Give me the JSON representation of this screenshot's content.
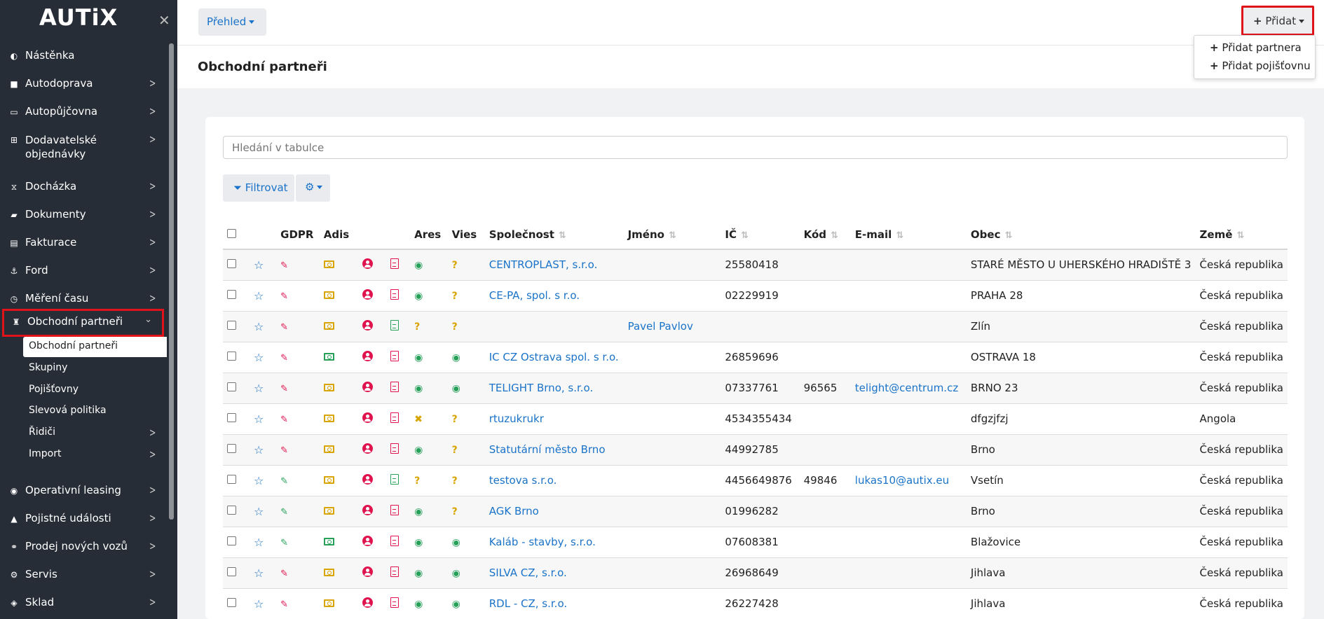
{
  "app": {
    "logo": "AUTiX"
  },
  "sidebar": {
    "items": [
      {
        "label": "Nástěnka",
        "icon": "dashboard-icon"
      },
      {
        "label": "Autodoprava",
        "icon": "truck-icon"
      },
      {
        "label": "Autopůjčovna",
        "icon": "car-rental-icon"
      },
      {
        "label": "Dodavatelské objednávky",
        "icon": "cart-icon"
      },
      {
        "label": "Docházka",
        "icon": "hourglass-icon"
      },
      {
        "label": "Dokumenty",
        "icon": "folder-icon"
      },
      {
        "label": "Fakturace",
        "icon": "invoice-icon"
      },
      {
        "label": "Ford",
        "icon": "anchor-icon"
      },
      {
        "label": "Měření času",
        "icon": "clock-icon"
      },
      {
        "label": "Obchodní partneři",
        "icon": "partners-icon"
      },
      {
        "label": "Operativní leasing",
        "icon": "car-icon"
      },
      {
        "label": "Pojistné události",
        "icon": "warning-icon"
      },
      {
        "label": "Prodej nových vozů",
        "icon": "handshake-icon"
      },
      {
        "label": "Servis",
        "icon": "cogs-icon"
      },
      {
        "label": "Sklad",
        "icon": "box-icon"
      }
    ],
    "subitems": [
      {
        "label": "Obchodní partneři"
      },
      {
        "label": "Skupiny"
      },
      {
        "label": "Pojišťovny"
      },
      {
        "label": "Slevová politika"
      },
      {
        "label": "Řidiči"
      },
      {
        "label": "Import"
      }
    ]
  },
  "topbar": {
    "overview_label": "Přehled",
    "add_label": "Přidat",
    "add_menu": [
      "Přidat partnera",
      "Přidat pojišťovnu"
    ]
  },
  "page": {
    "title": "Obchodní partneři"
  },
  "toolbar": {
    "search_placeholder": "Hledání v tabulce",
    "filter_label": "Filtrovat"
  },
  "table": {
    "columns": [
      "GDPR",
      "Adis",
      "Ares",
      "Vies",
      "Společnost",
      "Jméno",
      "IČ",
      "Kód",
      "E-mail",
      "Obec",
      "Země"
    ],
    "rows": [
      {
        "gdpr": "red",
        "adis": "yellow",
        "doc": "red",
        "ares": "eye",
        "vies": "q",
        "company": "CENTROPLAST, s.r.o.",
        "name": "",
        "ic": "25580418",
        "kod": "",
        "email": "",
        "obec": "STARÉ MĚSTO U UHERSKÉHO HRADIŠTĚ 3",
        "zeme": "Česká republika"
      },
      {
        "gdpr": "red",
        "adis": "yellow",
        "doc": "red",
        "ares": "eye",
        "vies": "q",
        "company": "CE-PA, spol. s r.o.",
        "name": "",
        "ic": "02229919",
        "kod": "",
        "email": "",
        "obec": "PRAHA 28",
        "zeme": "Česká republika"
      },
      {
        "gdpr": "red",
        "adis": "yellow",
        "doc": "green",
        "ares": "q",
        "vies": "q",
        "company": "",
        "name": "Pavel Pavlov",
        "ic": "",
        "kod": "",
        "email": "",
        "obec": "Zlín",
        "zeme": "Česká republika"
      },
      {
        "gdpr": "red",
        "adis": "green",
        "doc": "red",
        "ares": "eye",
        "vies": "eye",
        "company": "IC CZ Ostrava spol. s r.o.",
        "name": "",
        "ic": "26859696",
        "kod": "",
        "email": "",
        "obec": "OSTRAVA 18",
        "zeme": "Česká republika"
      },
      {
        "gdpr": "red",
        "adis": "yellow",
        "doc": "red",
        "ares": "eye",
        "vies": "eye",
        "company": "TELIGHT Brno, s.r.o.",
        "name": "",
        "ic": "07337761",
        "kod": "96565",
        "email": "telight@centrum.cz",
        "obec": "BRNO 23",
        "zeme": "Česká republika"
      },
      {
        "gdpr": "red",
        "adis": "yellow",
        "doc": "red",
        "ares": "x",
        "vies": "q",
        "company": "rtuzukrukr",
        "name": "",
        "ic": "4534355434",
        "kod": "",
        "email": "",
        "obec": "dfgzjfzj",
        "zeme": "Angola"
      },
      {
        "gdpr": "red",
        "adis": "yellow",
        "doc": "red",
        "ares": "eye",
        "vies": "q",
        "company": "Statutární město Brno",
        "name": "",
        "ic": "44992785",
        "kod": "",
        "email": "",
        "obec": "Brno",
        "zeme": "Česká republika"
      },
      {
        "gdpr": "green",
        "adis": "yellow",
        "doc": "green",
        "ares": "q",
        "vies": "q",
        "company": "testova s.r.o.",
        "name": "",
        "ic": "4456649876",
        "kod": "49846",
        "email": "lukas10@autix.eu",
        "obec": "Vsetín",
        "zeme": "Česká republika"
      },
      {
        "gdpr": "green",
        "adis": "yellow",
        "doc": "red",
        "ares": "eye",
        "vies": "q",
        "company": "AGK Brno",
        "name": "",
        "ic": "01996282",
        "kod": "",
        "email": "",
        "obec": "Brno",
        "zeme": "Česká republika"
      },
      {
        "gdpr": "green",
        "adis": "green",
        "doc": "red",
        "ares": "eye",
        "vies": "eye",
        "company": "Kaláb - stavby, s.r.o.",
        "name": "",
        "ic": "07608381",
        "kod": "",
        "email": "",
        "obec": "Blažovice",
        "zeme": "Česká republika"
      },
      {
        "gdpr": "red",
        "adis": "yellow",
        "doc": "red",
        "ares": "eye",
        "vies": "eye",
        "company": "SILVA CZ, s.r.o.",
        "name": "",
        "ic": "26968649",
        "kod": "",
        "email": "",
        "obec": "Jihlava",
        "zeme": "Česká republika"
      },
      {
        "gdpr": "red",
        "adis": "yellow",
        "doc": "red",
        "ares": "eye",
        "vies": "eye",
        "company": "RDL - CZ, s.r.o.",
        "name": "",
        "ic": "26227428",
        "kod": "",
        "email": "",
        "obec": "Jihlava",
        "zeme": "Česká republika"
      }
    ]
  },
  "colors": {
    "sidebar_bg": "#272d36",
    "link": "#1a73c9",
    "highlight": "#e0131b",
    "danger": "#e0134e",
    "success": "#27a05a",
    "warning": "#d8a400"
  }
}
